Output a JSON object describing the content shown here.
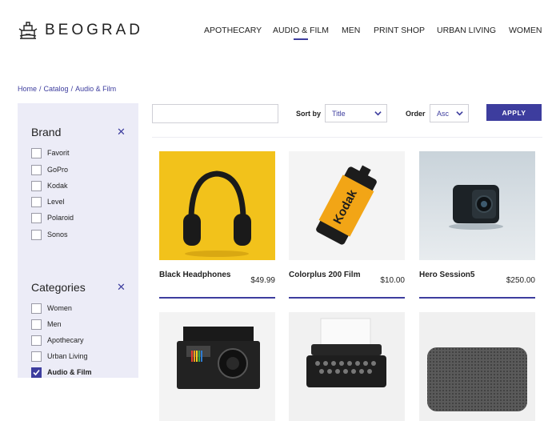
{
  "brand": {
    "name": "BEOGRAD"
  },
  "nav": {
    "items": [
      "APOTHECARY",
      "AUDIO & FILM",
      "MEN",
      "PRINT SHOP",
      "URBAN LIVING",
      "WOMEN"
    ],
    "active": "AUDIO & FILM"
  },
  "breadcrumb": [
    "Home",
    "Catalog",
    "Audio & Film"
  ],
  "filters": {
    "brand": {
      "title": "Brand",
      "options": [
        "Favorit",
        "GoPro",
        "Kodak",
        "Level",
        "Polaroid",
        "Sonos"
      ]
    },
    "categories": {
      "title": "Categories",
      "options": [
        "Women",
        "Men",
        "Apothecary",
        "Urban Living",
        "Audio & Film"
      ],
      "checked": "Audio & Film"
    }
  },
  "toolbar": {
    "search_value": "",
    "sort_label": "Sort by",
    "sort_value": "Title",
    "order_label": "Order",
    "order_value": "Asc",
    "apply_label": "APPLY"
  },
  "products": [
    {
      "name": "Black Headphones",
      "price": "$49.99",
      "image": "headphones"
    },
    {
      "name": "Colorplus 200 Film",
      "price": "$10.00",
      "image": "film-roll"
    },
    {
      "name": "Hero Session5",
      "price": "$250.00",
      "image": "action-camera"
    },
    {
      "name": "",
      "price": "",
      "image": "instant-camera"
    },
    {
      "name": "",
      "price": "",
      "image": "typewriter"
    },
    {
      "name": "",
      "price": "",
      "image": "speaker"
    }
  ],
  "colors": {
    "accent": "#3d3d9e",
    "sidebar_bg": "#ececf7"
  }
}
